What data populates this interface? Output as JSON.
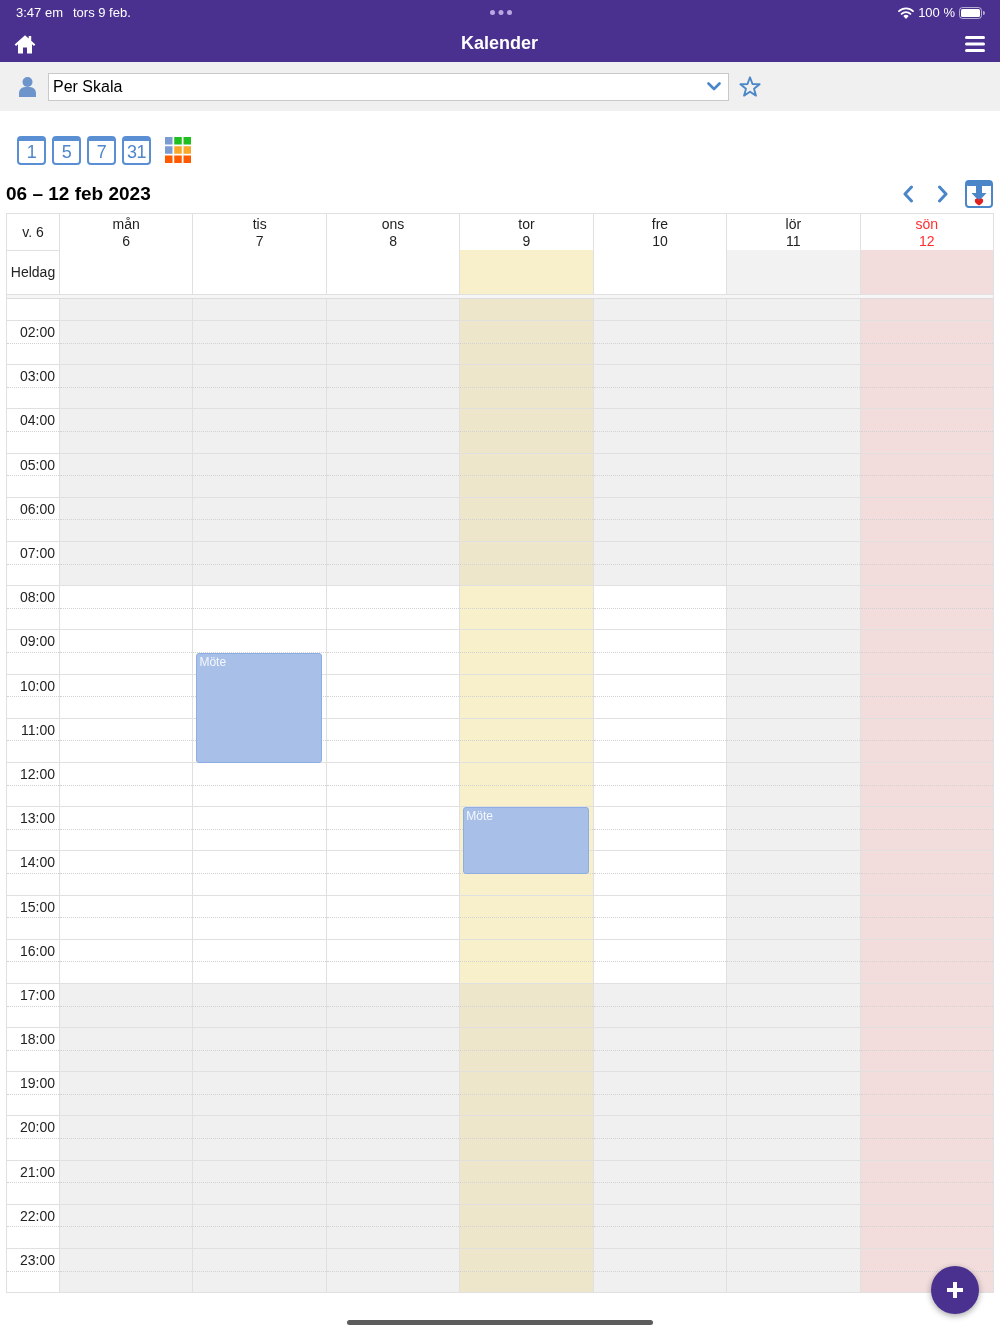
{
  "status_bar": {
    "time": "3:47 em",
    "date": "tors 9 feb.",
    "battery": "100 %"
  },
  "header": {
    "title": "Kalender"
  },
  "person_select": {
    "value": "Per Skala"
  },
  "view_buttons": [
    {
      "kind": "calendar",
      "label": "1"
    },
    {
      "kind": "calendar",
      "label": "5"
    },
    {
      "kind": "calendar",
      "label": "7"
    },
    {
      "kind": "calendar",
      "label": "31"
    },
    {
      "kind": "grid"
    }
  ],
  "range_title": "06 – 12 feb 2023",
  "week": {
    "week_label": "v. 6",
    "all_day_label": "Heldag",
    "hours": [
      {
        "kind": "partial"
      },
      {
        "kind": "off",
        "label": "02:00"
      },
      {
        "kind": "off",
        "label": "03:00"
      },
      {
        "kind": "off",
        "label": "04:00"
      },
      {
        "kind": "off",
        "label": "05:00"
      },
      {
        "kind": "off",
        "label": "06:00"
      },
      {
        "kind": "off",
        "label": "07:00"
      },
      {
        "kind": "work",
        "label": "08:00"
      },
      {
        "kind": "work",
        "label": "09:00"
      },
      {
        "kind": "work",
        "label": "10:00"
      },
      {
        "kind": "work",
        "label": "11:00"
      },
      {
        "kind": "work",
        "label": "12:00"
      },
      {
        "kind": "work",
        "label": "13:00"
      },
      {
        "kind": "work",
        "label": "14:00"
      },
      {
        "kind": "work",
        "label": "15:00"
      },
      {
        "kind": "work",
        "label": "16:00"
      },
      {
        "kind": "off",
        "label": "17:00"
      },
      {
        "kind": "off",
        "label": "18:00"
      },
      {
        "kind": "off",
        "label": "19:00"
      },
      {
        "kind": "off",
        "label": "20:00"
      },
      {
        "kind": "off",
        "label": "21:00"
      },
      {
        "kind": "off",
        "label": "22:00"
      },
      {
        "kind": "off",
        "label": "23:00"
      }
    ],
    "days": [
      {
        "name": "mån",
        "date": "6",
        "kind": "weekday",
        "slots": [
          {
            "kind": "free"
          },
          {
            "kind": "free"
          },
          {
            "kind": "free"
          },
          {
            "kind": "free"
          },
          {
            "kind": "free"
          },
          {
            "kind": "free"
          },
          {
            "kind": "free"
          },
          {
            "kind": "free"
          },
          {
            "kind": "free"
          },
          {
            "kind": "free"
          },
          {
            "kind": "free"
          },
          {
            "kind": "free"
          },
          {
            "kind": "free"
          },
          {
            "kind": "free"
          },
          {
            "kind": "free"
          },
          {
            "kind": "free"
          },
          {
            "kind": "free"
          },
          {
            "kind": "free"
          },
          {
            "kind": "free"
          },
          {
            "kind": "free"
          },
          {
            "kind": "free"
          },
          {
            "kind": "free"
          },
          {
            "kind": "free"
          },
          {
            "kind": "free"
          },
          {
            "kind": "free"
          },
          {
            "kind": "free"
          },
          {
            "kind": "free"
          },
          {
            "kind": "free"
          },
          {
            "kind": "free"
          },
          {
            "kind": "free"
          },
          {
            "kind": "free"
          },
          {
            "kind": "free"
          },
          {
            "kind": "free"
          },
          {
            "kind": "free"
          },
          {
            "kind": "free"
          },
          {
            "kind": "free"
          },
          {
            "kind": "free"
          },
          {
            "kind": "free"
          },
          {
            "kind": "free"
          },
          {
            "kind": "free"
          },
          {
            "kind": "free"
          },
          {
            "kind": "free"
          },
          {
            "kind": "free"
          },
          {
            "kind": "free"
          },
          {
            "kind": "free"
          }
        ]
      },
      {
        "name": "tis",
        "date": "7",
        "kind": "weekday",
        "slots": [
          {
            "kind": "free"
          },
          {
            "kind": "free"
          },
          {
            "kind": "free"
          },
          {
            "kind": "free"
          },
          {
            "kind": "free"
          },
          {
            "kind": "free"
          },
          {
            "kind": "free"
          },
          {
            "kind": "free"
          },
          {
            "kind": "free"
          },
          {
            "kind": "free"
          },
          {
            "kind": "free"
          },
          {
            "kind": "free"
          },
          {
            "kind": "free"
          },
          {
            "kind": "free"
          },
          {
            "kind": "free"
          },
          {
            "kind": "free"
          },
          {
            "kind": "event",
            "title": "Möte"
          },
          {
            "kind": "event"
          },
          {
            "kind": "event"
          },
          {
            "kind": "event"
          },
          {
            "kind": "event"
          },
          {
            "kind": "free"
          },
          {
            "kind": "free"
          },
          {
            "kind": "free"
          },
          {
            "kind": "free"
          },
          {
            "kind": "free"
          },
          {
            "kind": "free"
          },
          {
            "kind": "free"
          },
          {
            "kind": "free"
          },
          {
            "kind": "free"
          },
          {
            "kind": "free"
          },
          {
            "kind": "free"
          },
          {
            "kind": "free"
          },
          {
            "kind": "free"
          },
          {
            "kind": "free"
          },
          {
            "kind": "free"
          },
          {
            "kind": "free"
          },
          {
            "kind": "free"
          },
          {
            "kind": "free"
          },
          {
            "kind": "free"
          },
          {
            "kind": "free"
          },
          {
            "kind": "free"
          },
          {
            "kind": "free"
          },
          {
            "kind": "free"
          },
          {
            "kind": "free"
          }
        ]
      },
      {
        "name": "ons",
        "date": "8",
        "kind": "weekday",
        "slots": [
          {
            "kind": "free"
          },
          {
            "kind": "free"
          },
          {
            "kind": "free"
          },
          {
            "kind": "free"
          },
          {
            "kind": "free"
          },
          {
            "kind": "free"
          },
          {
            "kind": "free"
          },
          {
            "kind": "free"
          },
          {
            "kind": "free"
          },
          {
            "kind": "free"
          },
          {
            "kind": "free"
          },
          {
            "kind": "free"
          },
          {
            "kind": "free"
          },
          {
            "kind": "free"
          },
          {
            "kind": "free"
          },
          {
            "kind": "free"
          },
          {
            "kind": "free"
          },
          {
            "kind": "free"
          },
          {
            "kind": "free"
          },
          {
            "kind": "free"
          },
          {
            "kind": "free"
          },
          {
            "kind": "free"
          },
          {
            "kind": "free"
          },
          {
            "kind": "free"
          },
          {
            "kind": "free"
          },
          {
            "kind": "free"
          },
          {
            "kind": "free"
          },
          {
            "kind": "free"
          },
          {
            "kind": "free"
          },
          {
            "kind": "free"
          },
          {
            "kind": "free"
          },
          {
            "kind": "free"
          },
          {
            "kind": "free"
          },
          {
            "kind": "free"
          },
          {
            "kind": "free"
          },
          {
            "kind": "free"
          },
          {
            "kind": "free"
          },
          {
            "kind": "free"
          },
          {
            "kind": "free"
          },
          {
            "kind": "free"
          },
          {
            "kind": "free"
          },
          {
            "kind": "free"
          },
          {
            "kind": "free"
          },
          {
            "kind": "free"
          },
          {
            "kind": "free"
          }
        ]
      },
      {
        "name": "tor",
        "date": "9",
        "kind": "today",
        "slots": [
          {
            "kind": "free"
          },
          {
            "kind": "free"
          },
          {
            "kind": "free"
          },
          {
            "kind": "free"
          },
          {
            "kind": "free"
          },
          {
            "kind": "free"
          },
          {
            "kind": "free"
          },
          {
            "kind": "free"
          },
          {
            "kind": "free"
          },
          {
            "kind": "free"
          },
          {
            "kind": "free"
          },
          {
            "kind": "free"
          },
          {
            "kind": "free"
          },
          {
            "kind": "free"
          },
          {
            "kind": "free"
          },
          {
            "kind": "free"
          },
          {
            "kind": "free"
          },
          {
            "kind": "free"
          },
          {
            "kind": "free"
          },
          {
            "kind": "free"
          },
          {
            "kind": "free"
          },
          {
            "kind": "free"
          },
          {
            "kind": "free"
          },
          {
            "kind": "event",
            "title": "Möte"
          },
          {
            "kind": "event"
          },
          {
            "kind": "event"
          },
          {
            "kind": "free"
          },
          {
            "kind": "free"
          },
          {
            "kind": "free"
          },
          {
            "kind": "free"
          },
          {
            "kind": "free"
          },
          {
            "kind": "free"
          },
          {
            "kind": "free"
          },
          {
            "kind": "free"
          },
          {
            "kind": "free"
          },
          {
            "kind": "free"
          },
          {
            "kind": "free"
          },
          {
            "kind": "free"
          },
          {
            "kind": "free"
          },
          {
            "kind": "free"
          },
          {
            "kind": "free"
          },
          {
            "kind": "free"
          },
          {
            "kind": "free"
          },
          {
            "kind": "free"
          },
          {
            "kind": "free"
          }
        ]
      },
      {
        "name": "fre",
        "date": "10",
        "kind": "weekday",
        "slots": [
          {
            "kind": "free"
          },
          {
            "kind": "free"
          },
          {
            "kind": "free"
          },
          {
            "kind": "free"
          },
          {
            "kind": "free"
          },
          {
            "kind": "free"
          },
          {
            "kind": "free"
          },
          {
            "kind": "free"
          },
          {
            "kind": "free"
          },
          {
            "kind": "free"
          },
          {
            "kind": "free"
          },
          {
            "kind": "free"
          },
          {
            "kind": "free"
          },
          {
            "kind": "free"
          },
          {
            "kind": "free"
          },
          {
            "kind": "free"
          },
          {
            "kind": "free"
          },
          {
            "kind": "free"
          },
          {
            "kind": "free"
          },
          {
            "kind": "free"
          },
          {
            "kind": "free"
          },
          {
            "kind": "free"
          },
          {
            "kind": "free"
          },
          {
            "kind": "free"
          },
          {
            "kind": "free"
          },
          {
            "kind": "free"
          },
          {
            "kind": "free"
          },
          {
            "kind": "free"
          },
          {
            "kind": "free"
          },
          {
            "kind": "free"
          },
          {
            "kind": "free"
          },
          {
            "kind": "free"
          },
          {
            "kind": "free"
          },
          {
            "kind": "free"
          },
          {
            "kind": "free"
          },
          {
            "kind": "free"
          },
          {
            "kind": "free"
          },
          {
            "kind": "free"
          },
          {
            "kind": "free"
          },
          {
            "kind": "free"
          },
          {
            "kind": "free"
          },
          {
            "kind": "free"
          },
          {
            "kind": "free"
          },
          {
            "kind": "free"
          },
          {
            "kind": "free"
          }
        ]
      },
      {
        "name": "lör",
        "date": "11",
        "kind": "saturday",
        "slots": [
          {
            "kind": "free"
          },
          {
            "kind": "free"
          },
          {
            "kind": "free"
          },
          {
            "kind": "free"
          },
          {
            "kind": "free"
          },
          {
            "kind": "free"
          },
          {
            "kind": "free"
          },
          {
            "kind": "free"
          },
          {
            "kind": "free"
          },
          {
            "kind": "free"
          },
          {
            "kind": "free"
          },
          {
            "kind": "free"
          },
          {
            "kind": "free"
          },
          {
            "kind": "free"
          },
          {
            "kind": "free"
          },
          {
            "kind": "free"
          },
          {
            "kind": "free"
          },
          {
            "kind": "free"
          },
          {
            "kind": "free"
          },
          {
            "kind": "free"
          },
          {
            "kind": "free"
          },
          {
            "kind": "free"
          },
          {
            "kind": "free"
          },
          {
            "kind": "free"
          },
          {
            "kind": "free"
          },
          {
            "kind": "free"
          },
          {
            "kind": "free"
          },
          {
            "kind": "free"
          },
          {
            "kind": "free"
          },
          {
            "kind": "free"
          },
          {
            "kind": "free"
          },
          {
            "kind": "free"
          },
          {
            "kind": "free"
          },
          {
            "kind": "free"
          },
          {
            "kind": "free"
          },
          {
            "kind": "free"
          },
          {
            "kind": "free"
          },
          {
            "kind": "free"
          },
          {
            "kind": "free"
          },
          {
            "kind": "free"
          },
          {
            "kind": "free"
          },
          {
            "kind": "free"
          },
          {
            "kind": "free"
          },
          {
            "kind": "free"
          },
          {
            "kind": "free"
          }
        ]
      },
      {
        "name": "sön",
        "date": "12",
        "kind": "sunday",
        "slots": [
          {
            "kind": "free"
          },
          {
            "kind": "free"
          },
          {
            "kind": "free"
          },
          {
            "kind": "free"
          },
          {
            "kind": "free"
          },
          {
            "kind": "free"
          },
          {
            "kind": "free"
          },
          {
            "kind": "free"
          },
          {
            "kind": "free"
          },
          {
            "kind": "free"
          },
          {
            "kind": "free"
          },
          {
            "kind": "free"
          },
          {
            "kind": "free"
          },
          {
            "kind": "free"
          },
          {
            "kind": "free"
          },
          {
            "kind": "free"
          },
          {
            "kind": "free"
          },
          {
            "kind": "free"
          },
          {
            "kind": "free"
          },
          {
            "kind": "free"
          },
          {
            "kind": "free"
          },
          {
            "kind": "free"
          },
          {
            "kind": "free"
          },
          {
            "kind": "free"
          },
          {
            "kind": "free"
          },
          {
            "kind": "free"
          },
          {
            "kind": "free"
          },
          {
            "kind": "free"
          },
          {
            "kind": "free"
          },
          {
            "kind": "free"
          },
          {
            "kind": "free"
          },
          {
            "kind": "free"
          },
          {
            "kind": "free"
          },
          {
            "kind": "free"
          },
          {
            "kind": "free"
          },
          {
            "kind": "free"
          },
          {
            "kind": "free"
          },
          {
            "kind": "free"
          },
          {
            "kind": "free"
          },
          {
            "kind": "free"
          },
          {
            "kind": "free"
          },
          {
            "kind": "free"
          },
          {
            "kind": "free"
          },
          {
            "kind": "free"
          },
          {
            "kind": "free"
          }
        ]
      }
    ]
  }
}
